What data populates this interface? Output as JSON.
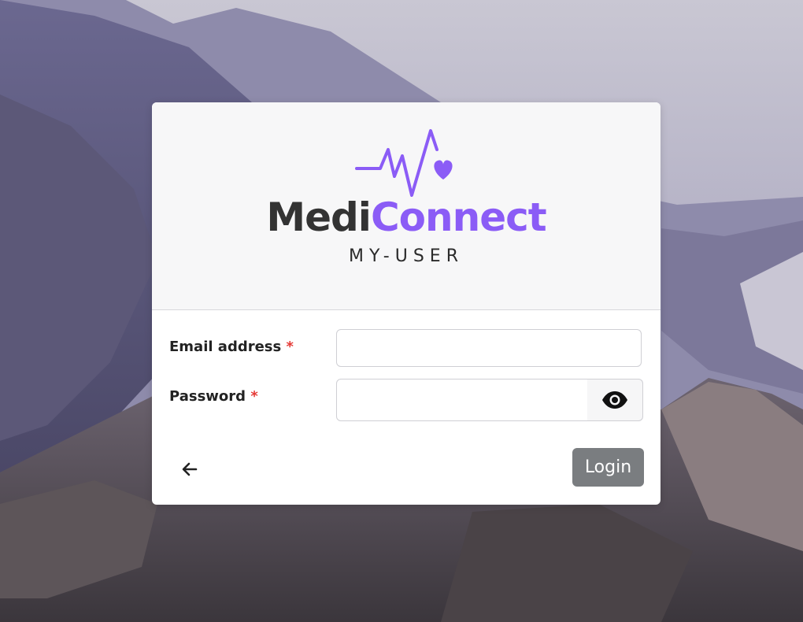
{
  "brand": {
    "name_part1": "Medi",
    "name_part2": "Connect",
    "subtitle": "MY-USER",
    "accent_color": "#8b5cf6",
    "dark_color": "#333333"
  },
  "form": {
    "email_label": "Email address",
    "password_label": "Password",
    "required_marker": "*",
    "email_value": "",
    "password_value": ""
  },
  "actions": {
    "login_label": "Login",
    "back_icon": "arrow-left-icon",
    "toggle_password_icon": "eye-icon"
  }
}
